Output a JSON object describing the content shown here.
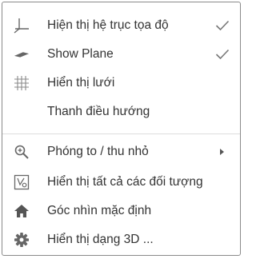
{
  "menu": {
    "items": [
      {
        "label": "Hiện thị hệ trục tọa độ",
        "icon": "axes-icon",
        "checked": true
      },
      {
        "label": "Show Plane",
        "icon": "plane-icon",
        "checked": true
      },
      {
        "label": "Hiển thị lưới",
        "icon": "grid-icon",
        "checked": false
      },
      {
        "label": "Thanh điều hướng",
        "icon": "",
        "checked": false
      },
      {
        "label": "Phóng to / thu nhỏ",
        "icon": "zoom-icon",
        "submenu": true
      },
      {
        "label": "Hiển thị tất cả các đối tượng",
        "icon": "show-all-objects-icon"
      },
      {
        "label": "Góc nhìn mặc định",
        "icon": "home-icon"
      },
      {
        "label": "Hiển thị dạng 3D ...",
        "icon": "gear-icon"
      }
    ]
  },
  "colors": {
    "text": "#333333",
    "icon": "#666666",
    "check": "#777777",
    "divider": "#dddddd",
    "border": "#8a8a8a"
  }
}
